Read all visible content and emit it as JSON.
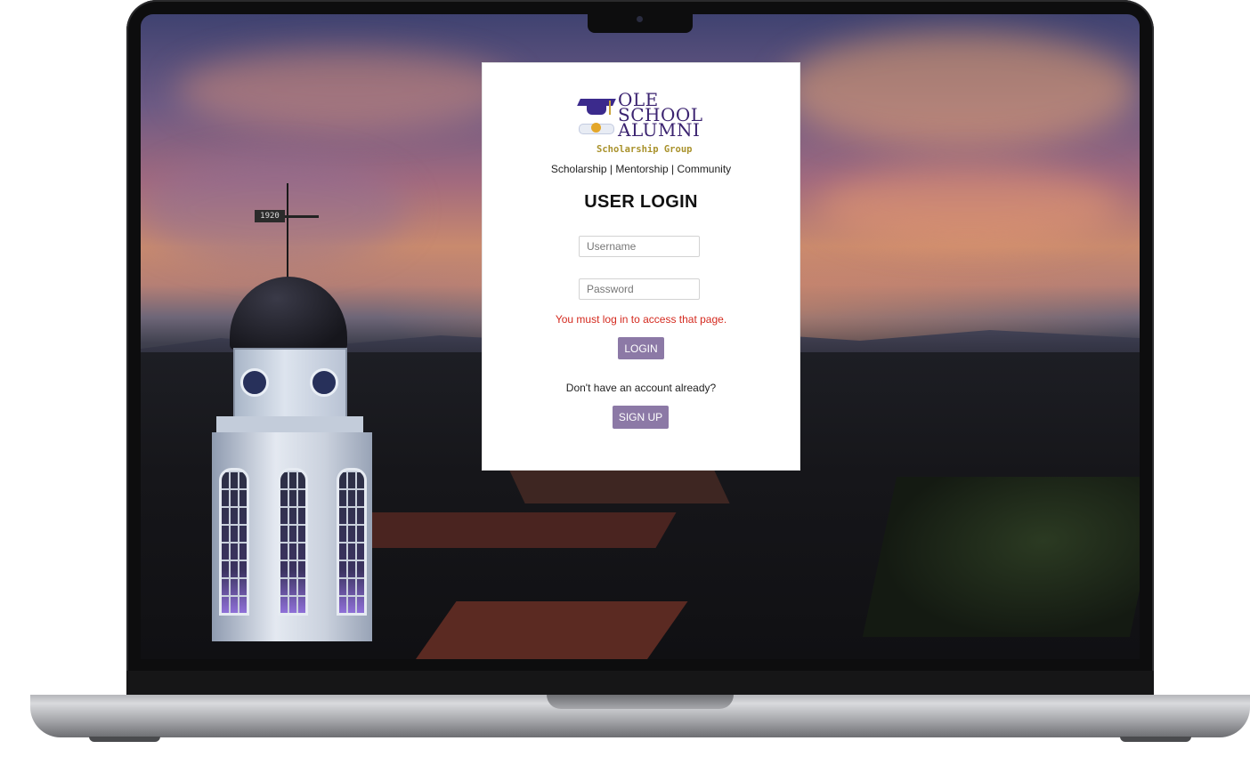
{
  "card": {
    "logo": {
      "line1": "OLE",
      "line2": "SCHOOL",
      "line3": "ALUMNI",
      "subtitle": "Scholarship Group"
    },
    "tagline": "Scholarship | Mentorship | Community",
    "title": "USER LOGIN",
    "username": {
      "placeholder": "Username",
      "value": ""
    },
    "password": {
      "placeholder": "Password",
      "value": ""
    },
    "error": "You must log in to access that page.",
    "login_label": "LOGIN",
    "signup_prompt": "Don't have an account already?",
    "signup_label": "SIGN UP"
  },
  "background": {
    "weather_vane_year": "1920"
  },
  "colors": {
    "button": "#8c79a6",
    "error": "#d42a1f",
    "brand_purple": "#3b2370",
    "brand_gold": "#a9922c"
  },
  "icons": [
    "graduation-cap-icon",
    "diploma-scroll-icon"
  ]
}
